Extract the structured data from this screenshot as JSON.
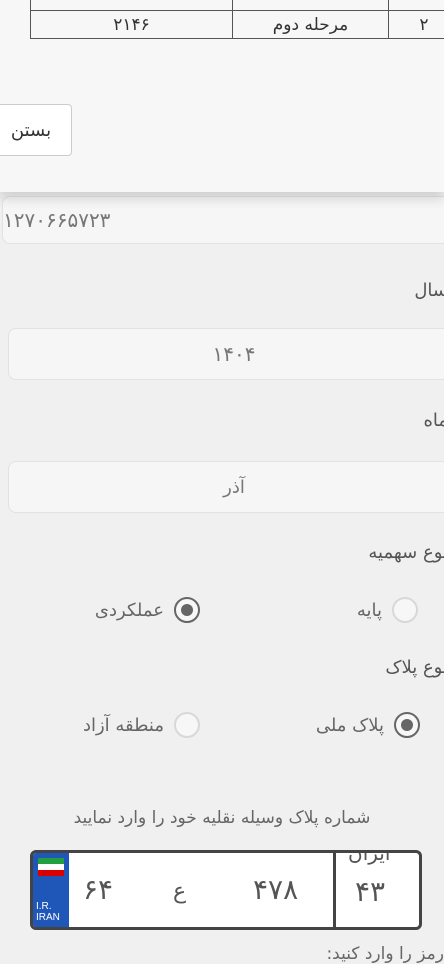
{
  "modal": {
    "table_rows": [
      {
        "index": "",
        "stage": "",
        "value": ""
      },
      {
        "index": "۲",
        "stage": "مرحله دوم",
        "value": "۲۱۴۶"
      }
    ],
    "close_label": "بستن"
  },
  "form": {
    "top_value": "۱۲۷۰۶۶۵۷۲۳",
    "year_label": "سال",
    "year_value": "۱۴۰۴",
    "month_label": "ماه",
    "month_value": "آذر",
    "quota_type_label": "نوع سهمیه",
    "quota_options": [
      {
        "label": "پایه",
        "selected": false
      },
      {
        "label": "عملکردی",
        "selected": true
      }
    ],
    "plate_type_label": "نوع پلاک",
    "plate_options": [
      {
        "label": "پلاک ملی",
        "selected": true
      },
      {
        "label": "منطقه آزاد",
        "selected": false
      }
    ],
    "plate_hint": "شماره پلاک وسیله نقلیه خود را وارد نمایید",
    "plate": {
      "part1": "۶۴",
      "letter": "ع",
      "part2": "۴۷۸",
      "region": "۴۳",
      "iran_word": "ایران",
      "ir_text": "I.R.",
      "iran_text": "IRAN"
    },
    "bottom_hint": "رمز را وارد کنید:"
  },
  "colors": {
    "accent": "#1f57b8",
    "background": "#f0f0f0"
  }
}
